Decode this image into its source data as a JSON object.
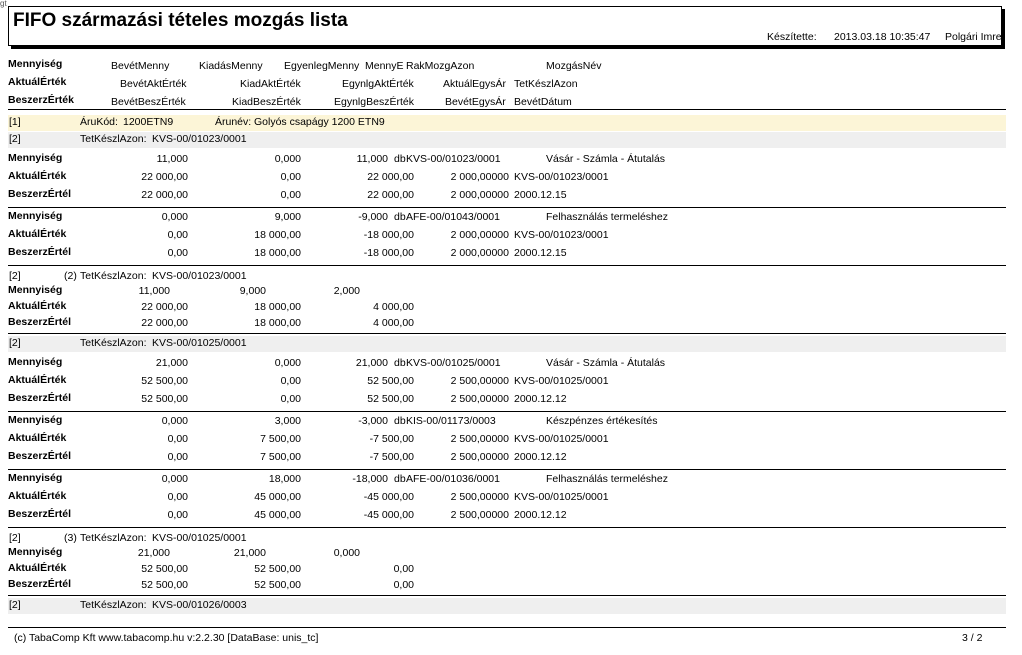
{
  "corner_mark": "gt",
  "title": "FIFO származási tételes mozgás lista",
  "created": {
    "label": "Készítette:",
    "datetime": "2013.03.18 10:35:47",
    "user": "Polgári Imre"
  },
  "header": {
    "row1": {
      "label": "Mennyiség",
      "c1": "BevétMenny",
      "c2": "KiadásMenny",
      "c3": "EgyenlegMenny",
      "c4": "MennyE",
      "c5": "RakMozgAzon",
      "c6": "MozgásNév"
    },
    "row2": {
      "label": "AktuálÉrték",
      "c1": "BevétAktÉrték",
      "c2": "KiadAktÉrték",
      "c3": "EgynlgAktÉrték",
      "c4": "AktuálEgysÁr",
      "c5": "TetKészlAzon"
    },
    "row3": {
      "label": "BeszerzÉrték",
      "c1": "BevétBeszÉrték",
      "c2": "KiadBeszÉrték",
      "c3": "EgynlgBeszÉrték",
      "c4": "BevétEgysÁr",
      "c5": "BevétDátum"
    }
  },
  "labels": {
    "mennyiseg": "Mennyiség",
    "aktual": "AktuálÉrték",
    "beszerz": "BeszerzÉrtél"
  },
  "item_band": {
    "num": "[1]",
    "code_label": "ÁruKód:",
    "code": "1200ETN9",
    "name_label": "Árunév:",
    "name": "Golyós csapágy 1200 ETN9"
  },
  "sections": [
    {
      "type": "band",
      "top": 0,
      "num": "[2]",
      "prefix": "",
      "label": "TetKészlAzon:",
      "value": "KVS-00/01023/0001"
    },
    {
      "type": "move",
      "rows": [
        [
          "11,000",
          "0,000",
          "11,000",
          "db",
          "KVS-00/01023/0001",
          "Vásár - Számla - Átutalás"
        ],
        [
          "22 000,00",
          "0,00",
          "22 000,00",
          "2 000,00000",
          "KVS-00/01023/0001"
        ],
        [
          "22 000,00",
          "0,00",
          "22 000,00",
          "2 000,00000",
          "2000.12.15"
        ]
      ]
    },
    {
      "type": "move",
      "rows": [
        [
          "0,000",
          "9,000",
          "-9,000",
          "db",
          "AFE-00/01043/0001",
          "Felhasználás termeléshez"
        ],
        [
          "0,00",
          "18 000,00",
          "-18 000,00",
          "2 000,00000",
          "KVS-00/01023/0001"
        ],
        [
          "0,00",
          "18 000,00",
          "-18 000,00",
          "2 000,00000",
          "2000.12.15"
        ]
      ]
    },
    {
      "type": "sum",
      "num": "[2]",
      "prefix": "(2)",
      "label": "TetKészlAzon:",
      "value": "KVS-00/01023/0001",
      "rows": [
        [
          "11,000",
          "9,000",
          "2,000"
        ],
        [
          "22 000,00",
          "18 000,00",
          "4 000,00"
        ],
        [
          "22 000,00",
          "18 000,00",
          "4 000,00"
        ]
      ]
    },
    {
      "type": "band",
      "num": "[2]",
      "prefix": "",
      "label": "TetKészlAzon:",
      "value": "KVS-00/01025/0001"
    },
    {
      "type": "move",
      "rows": [
        [
          "21,000",
          "0,000",
          "21,000",
          "db",
          "KVS-00/01025/0001",
          "Vásár - Számla - Átutalás"
        ],
        [
          "52 500,00",
          "0,00",
          "52 500,00",
          "2 500,00000",
          "KVS-00/01025/0001"
        ],
        [
          "52 500,00",
          "0,00",
          "52 500,00",
          "2 500,00000",
          "2000.12.12"
        ]
      ]
    },
    {
      "type": "move",
      "rows": [
        [
          "0,000",
          "3,000",
          "-3,000",
          "db",
          "KIS-00/01173/0003",
          "Készpénzes értékesítés"
        ],
        [
          "0,00",
          "7 500,00",
          "-7 500,00",
          "2 500,00000",
          "KVS-00/01025/0001"
        ],
        [
          "0,00",
          "7 500,00",
          "-7 500,00",
          "2 500,00000",
          "2000.12.12"
        ]
      ]
    },
    {
      "type": "move",
      "rows": [
        [
          "0,000",
          "18,000",
          "-18,000",
          "db",
          "AFE-00/01036/0001",
          "Felhasználás termeléshez"
        ],
        [
          "0,00",
          "45 000,00",
          "-45 000,00",
          "2 500,00000",
          "KVS-00/01025/0001"
        ],
        [
          "0,00",
          "45 000,00",
          "-45 000,00",
          "2 500,00000",
          "2000.12.12"
        ]
      ]
    },
    {
      "type": "sum",
      "num": "[2]",
      "prefix": "(3)",
      "label": "TetKészlAzon:",
      "value": "KVS-00/01025/0001",
      "rows": [
        [
          "21,000",
          "21,000",
          "0,000"
        ],
        [
          "52 500,00",
          "52 500,00",
          "0,00"
        ],
        [
          "52 500,00",
          "52 500,00",
          "0,00"
        ]
      ]
    },
    {
      "type": "band",
      "num": "[2]",
      "prefix": "",
      "label": "TetKészlAzon:",
      "value": "KVS-00/01026/0003"
    }
  ],
  "footer": {
    "left": "(c) TabaComp Kft  www.tabacomp.hu  v:2.2.30 [DataBase: unis_tc]",
    "page": "3  / 2"
  }
}
